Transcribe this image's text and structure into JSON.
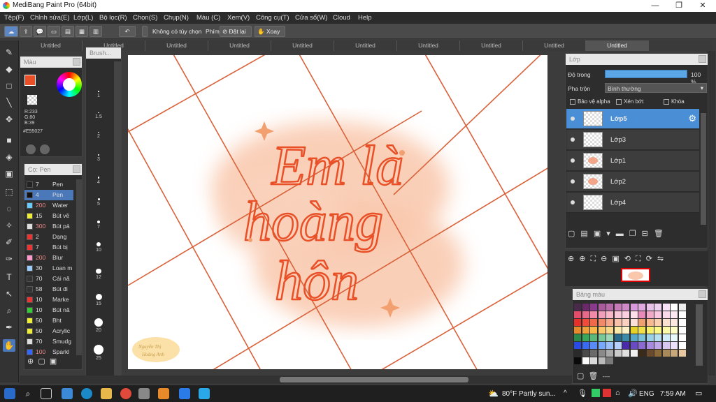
{
  "window": {
    "title": "MediBang Paint Pro (64bit)"
  },
  "menu": [
    "Tệp(F)",
    "Chỉnh sửa(E)",
    "Lớp(L)",
    "Bộ lọc(R)",
    "Chọn(S)",
    "Chụp(N)",
    "Màu (C)",
    "Xem(V)",
    "Công cụ(T)",
    "Cửa sổ(W)",
    "Cloud",
    "Help"
  ],
  "toolbar": {
    "no_option": "Không có tùy chọn",
    "hotkey": "Phím",
    "reset": "Đặt lại",
    "rotate": "Xoay"
  },
  "tabs": [
    "Untitled",
    "Untitled",
    "Untitled",
    "Untitled",
    "Untitled",
    "Untitled",
    "Untitled",
    "Untitled",
    "Untitled",
    "Untitled"
  ],
  "color_panel": {
    "title": "Màu",
    "r": "R:233",
    "g": "G:80",
    "b": "B:39",
    "hex": "#E95027",
    "primary": "#E95027"
  },
  "brush_panel": {
    "title": "Cọ: Pen",
    "items": [
      {
        "size": "7",
        "name": "Pen",
        "color": "#222"
      },
      {
        "size": "4",
        "name": "Pen",
        "color": "#111"
      },
      {
        "size": "200",
        "name": "Water",
        "color": "#6cf"
      },
      {
        "size": "15",
        "name": "Bút vẽ",
        "color": "#ee3"
      },
      {
        "size": "300",
        "name": "Bút pả",
        "color": "#ddd"
      },
      {
        "size": "2",
        "name": "Dạng",
        "color": "#e33"
      },
      {
        "size": "7",
        "name": "Bút bị",
        "color": "#e33"
      },
      {
        "size": "200",
        "name": "Blur",
        "color": "#f9c"
      },
      {
        "size": "30",
        "name": "Loan m",
        "color": "#9cf"
      },
      {
        "size": "70",
        "name": "Cái nă",
        "color": "#333"
      },
      {
        "size": "58",
        "name": "Bút đi",
        "color": "#333"
      },
      {
        "size": "10",
        "name": "Marke",
        "color": "#e33"
      },
      {
        "size": "10",
        "name": "Bút nă",
        "color": "#3c3"
      },
      {
        "size": "50",
        "name": "Bht",
        "color": "#ee3"
      },
      {
        "size": "50",
        "name": "Acrylic",
        "color": "#ee3"
      },
      {
        "size": "70",
        "name": "Smudg",
        "color": "#ddd"
      },
      {
        "size": "100",
        "name": "Sparkl",
        "color": "#36f"
      }
    ]
  },
  "brush_size_panel": {
    "title": "Brush...",
    "sizes": [
      "1",
      "1.5",
      "2",
      "3",
      "4",
      "5",
      "7",
      "10",
      "12",
      "15",
      "20",
      "25"
    ]
  },
  "layers_panel": {
    "title": "Lớp",
    "opacity_label": "Độ trong",
    "opacity_value": "100 %",
    "blend_label": "Pha trộn",
    "blend_value": "Bình thường",
    "protect_alpha": "Bảo vệ alpha",
    "clipping": "Xén bớt",
    "lock": "Khóa",
    "layers": [
      "Lớp5",
      "Lớp3",
      "Lớp1",
      "Lớp2",
      "Lớp4"
    ]
  },
  "palette_panel": {
    "title": "Bảng màu",
    "footer": "----"
  },
  "artwork": {
    "line1": "Em là",
    "line2": "hoàng",
    "line3": "hôn",
    "signature1": "Nguyễn Thị",
    "signature2": "Hoàng Anh"
  },
  "taskbar": {
    "weather": "80°F Partly sun...",
    "lang": "ENG",
    "time": "7:59 AM"
  }
}
